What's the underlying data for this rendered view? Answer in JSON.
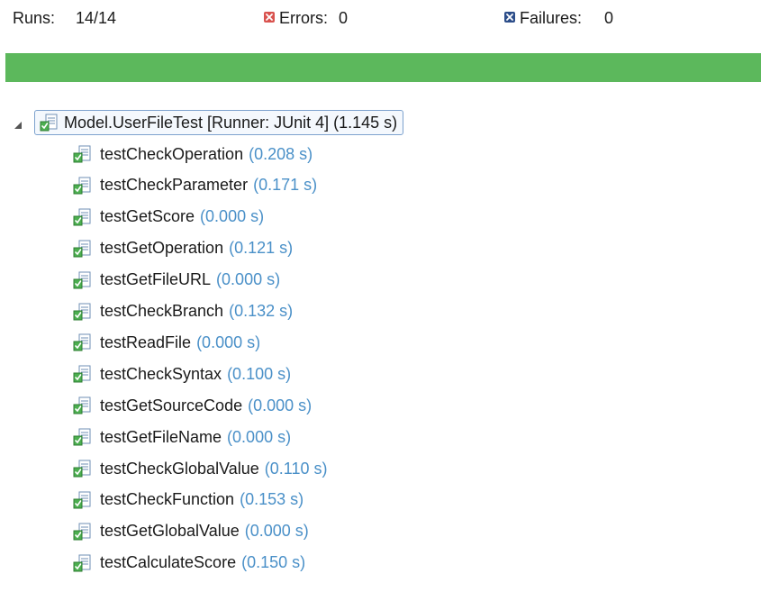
{
  "stats": {
    "runs_label": "Runs:",
    "runs_value": "14/14",
    "errors_label": "Errors:",
    "errors_value": "0",
    "failures_label": "Failures:",
    "failures_value": "0",
    "error_icon_color": "#d9534f",
    "failure_icon_color": "#2d4e8a"
  },
  "progress": {
    "fraction": 1.0,
    "color": "#5cb85c"
  },
  "tree": {
    "root": {
      "label": "Model.UserFileTest [Runner: JUnit 4] (1.145 s)",
      "icon": "test-suite-icon",
      "expanded": true
    },
    "tests": [
      {
        "name": "testCheckOperation",
        "time": "(0.208 s)"
      },
      {
        "name": "testCheckParameter",
        "time": "(0.171 s)"
      },
      {
        "name": "testGetScore",
        "time": "(0.000 s)"
      },
      {
        "name": "testGetOperation",
        "time": "(0.121 s)"
      },
      {
        "name": "testGetFileURL",
        "time": "(0.000 s)"
      },
      {
        "name": "testCheckBranch",
        "time": "(0.132 s)"
      },
      {
        "name": "testReadFile",
        "time": "(0.000 s)"
      },
      {
        "name": "testCheckSyntax",
        "time": "(0.100 s)"
      },
      {
        "name": "testGetSourceCode",
        "time": "(0.000 s)"
      },
      {
        "name": "testGetFileName",
        "time": "(0.000 s)"
      },
      {
        "name": "testCheckGlobalValue",
        "time": "(0.110 s)"
      },
      {
        "name": "testCheckFunction",
        "time": "(0.153 s)"
      },
      {
        "name": "testGetGlobalValue",
        "time": "(0.000 s)"
      },
      {
        "name": "testCalculateScore",
        "time": "(0.150 s)"
      }
    ],
    "test_icon": "test-passed-icon"
  }
}
